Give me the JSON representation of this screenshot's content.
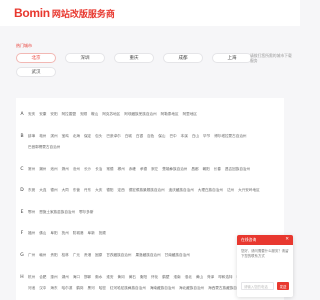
{
  "header": {
    "logo_mark": "Bomin",
    "logo_text": "网站改版服务商"
  },
  "hot": {
    "title": "热门城市",
    "cities": [
      "北京",
      "深圳",
      "重庆",
      "成都",
      "上海",
      "武汉"
    ]
  },
  "search_hint": "请拨打您所需的城市下载服务",
  "directory": [
    {
      "letter": "A",
      "cities": [
        "安庆",
        "安康",
        "安阳",
        "阿拉善盟",
        "安顺",
        "鞍山",
        "阿克苏地区",
        "阿坝藏族羌族自治州",
        "阿勒泰地区",
        "阿里地区"
      ]
    },
    {
      "letter": "B",
      "cities": [
        "蚌埠",
        "亳州",
        "滨州",
        "宝鸡",
        "北海",
        "保定",
        "包头",
        "巴彦淖尔",
        "白城",
        "白银",
        "百色",
        "保山",
        "巴中",
        "本溪",
        "白山",
        "毕节",
        "博尔塔拉蒙古自治州",
        "巴音郭楞蒙古自治州"
      ]
    },
    {
      "letter": "C",
      "cities": [
        "常州",
        "潮州",
        "池州",
        "滁州",
        "沧州",
        "长沙",
        "长治",
        "常德",
        "郴州",
        "赤峰",
        "承德",
        "崇左",
        "楚雄彝族自治州",
        "昌都",
        "朝阳",
        "长春",
        "昌吉回族自治州"
      ]
    },
    {
      "letter": "D",
      "cities": [
        "东莞",
        "大连",
        "德州",
        "大同",
        "东营",
        "丹东",
        "大庆",
        "德阳",
        "定西",
        "德宏傣族景颇族自治州",
        "迪庆藏族自治州",
        "大理白族自治州",
        "达州",
        "大兴安岭地区"
      ]
    },
    {
      "letter": "E",
      "cities": [
        "鄂州",
        "恩施土家族苗族自治州",
        "鄂尔多斯"
      ]
    },
    {
      "letter": "F",
      "cities": [
        "福州",
        "佛山",
        "阜阳",
        "抚州",
        "防城港",
        "阜新",
        "抚顺"
      ]
    },
    {
      "letter": "G",
      "cities": [
        "广州",
        "赣州",
        "贵阳",
        "桂林",
        "广元",
        "贵港",
        "固原",
        "甘孜藏族自治州",
        "果洛藏族自治州",
        "甘南藏族自治州"
      ]
    },
    {
      "letter": "H",
      "cities": [
        "杭州",
        "合肥",
        "惠州",
        "湖州",
        "海口",
        "邯郸",
        "衡水",
        "淮安",
        "黄冈",
        "黄石",
        "衡阳",
        "怀化",
        "鹤壁",
        "淮南",
        "淮北",
        "黄山",
        "菏泽",
        "呼和浩特",
        "呼伦贝尔",
        "河源",
        "贺州",
        "河池",
        "汉中",
        "海东",
        "哈尔滨",
        "鹤岗",
        "黑河",
        "哈密",
        "红河哈尼族彝族自治州",
        "海南藏族自治州",
        "海北藏族自治州",
        "海西蒙古族藏族自治州",
        "黄南藏族自治州"
      ]
    }
  ],
  "float_card": {
    "title": "在线咨询",
    "close": "✕",
    "message": "您好，请问需要什么服务？请留下您的联系方式",
    "input_placeholder": "请输入您的电话",
    "send_label": "发送"
  },
  "colors": {
    "brand": "#e8382f",
    "background": "#f6f6f8"
  },
  "icons": [
    "close-icon"
  ]
}
